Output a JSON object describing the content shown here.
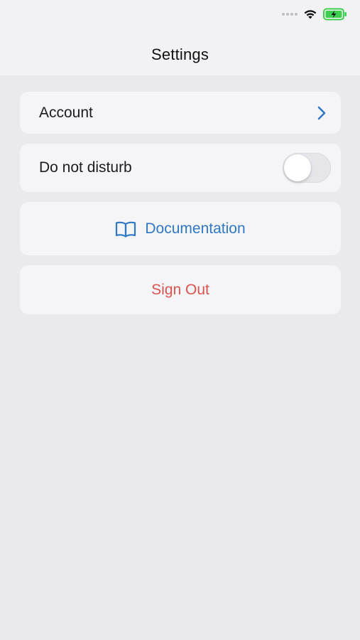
{
  "status_bar": {
    "wifi_icon": "wifi-icon",
    "battery_icon": "battery-charging-icon",
    "battery_color": "#3ccf4e"
  },
  "nav": {
    "title": "Settings"
  },
  "settings": {
    "account": {
      "label": "Account",
      "icon": "chevron-right-icon"
    },
    "do_not_disturb": {
      "label": "Do not disturb",
      "enabled": false
    },
    "documentation": {
      "label": "Documentation",
      "icon": "book-icon"
    },
    "sign_out": {
      "label": "Sign Out"
    }
  },
  "colors": {
    "accent": "#2f78c4",
    "destructive": "#d9534f",
    "background": "#e9e9ee",
    "card": "#f5f5f7"
  }
}
